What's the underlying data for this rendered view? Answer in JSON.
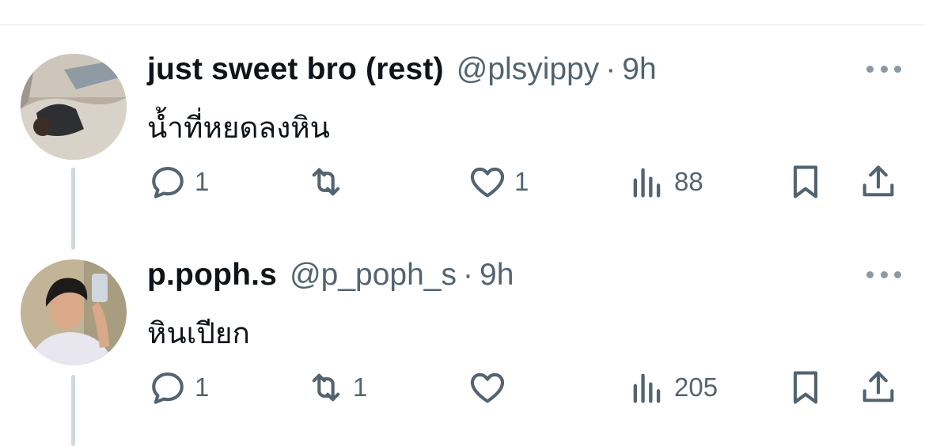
{
  "tweets": [
    {
      "display_name": "just sweet bro (rest)",
      "handle": "@plsyippy",
      "separator": "·",
      "time": "9h",
      "text": "น้ำที่หยดลงหิน",
      "stats": {
        "replies": "1",
        "retweets": "",
        "likes": "1",
        "views": "88"
      },
      "avatar_icon": "avatar-photo"
    },
    {
      "display_name": "p.poph.s",
      "handle": "@p_poph_s",
      "separator": "·",
      "time": "9h",
      "text": "หินเปียก",
      "stats": {
        "replies": "1",
        "retweets": "1",
        "likes": "",
        "views": "205"
      },
      "avatar_icon": "avatar-photo"
    }
  ],
  "icons": {
    "reply": "reply-icon",
    "retweet": "retweet-icon",
    "like": "heart-icon",
    "views": "views-icon",
    "bookmark": "bookmark-icon",
    "share": "share-icon",
    "more": "more-icon"
  },
  "colors": {
    "text": "#0f1419",
    "secondary": "#536471",
    "thread_line": "#cfd9de",
    "divider": "#e6e9ec"
  }
}
